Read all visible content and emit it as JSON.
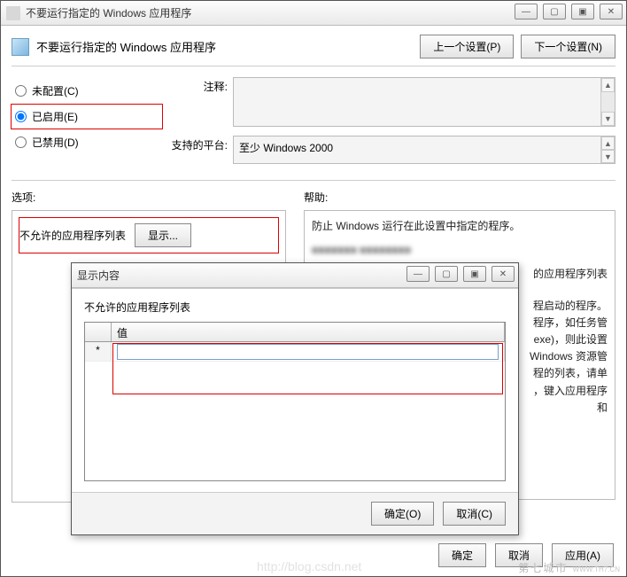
{
  "main": {
    "title": "不要运行指定的 Windows 应用程序",
    "header_title": "不要运行指定的 Windows 应用程序",
    "prev_btn": "上一个设置(P)",
    "next_btn": "下一个设置(N)",
    "radios": [
      {
        "label": "未配置(C)",
        "checked": false
      },
      {
        "label": "已启用(E)",
        "checked": true
      },
      {
        "label": "已禁用(D)",
        "checked": false
      }
    ],
    "comment_label": "注释:",
    "platform_label": "支持的平台:",
    "platform_value": "至少 Windows 2000",
    "options_label": "选项:",
    "help_label": "帮助:",
    "option_row_label": "不允许的应用程序列表",
    "show_btn": "显示...",
    "help_text": {
      "line1": "防止 Windows 运行在此设置中指定的程序。",
      "blurred1": "■■■■■■■  ■■■■■■■■",
      "tail_app_list": "的应用程序列表",
      "tail_launch": "程启动的程序。",
      "tail_taskmgr": "程序，如任务管",
      "tail_exe": "exe)，则此设置",
      "tail_resmgr": "Windows 资源管",
      "tail_list_click": "程的列表，请单",
      "tail_type_app": "，键入应用程序",
      "tail_and": "和"
    },
    "footer": {
      "ok": "确定",
      "cancel": "取消",
      "apply": "应用(A)"
    }
  },
  "dialog": {
    "title": "显示内容",
    "body_label": "不允许的应用程序列表",
    "col_value": "值",
    "new_marker": "*",
    "ok": "确定(O)",
    "cancel": "取消(C)"
  },
  "watermark": {
    "text": "第七城市",
    "sub": "WWW.TH7.CN"
  },
  "ghost_url": "http://blog.csdn.net"
}
